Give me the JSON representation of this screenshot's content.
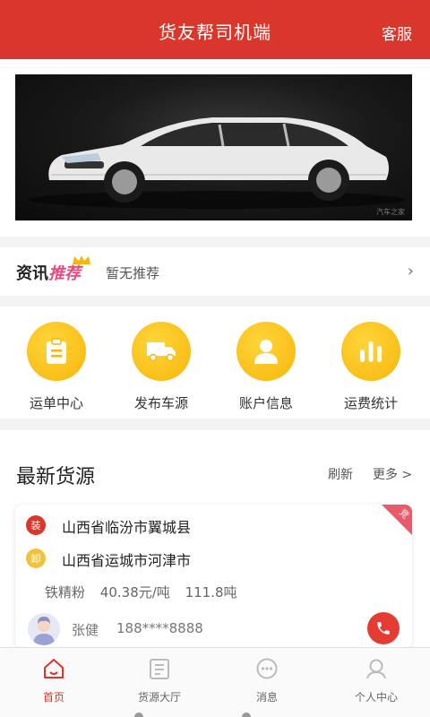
{
  "header": {
    "title": "货友帮司机端",
    "service": "客服"
  },
  "banner": {
    "watermark": "汽车之家"
  },
  "news": {
    "label_main": "资讯",
    "label_highlight": "推荐",
    "empty_text": "暂无推荐"
  },
  "menu": [
    {
      "label": "运单中心",
      "icon": "clipboard-icon"
    },
    {
      "label": "发布车源",
      "icon": "truck-icon"
    },
    {
      "label": "账户信息",
      "icon": "user-icon"
    },
    {
      "label": "运费统计",
      "icon": "bar-chart-icon"
    }
  ],
  "latest": {
    "heading": "最新货源",
    "refresh": "刷新",
    "more": "更多 >",
    "card": {
      "ribbon": "竞",
      "load_badge": "装",
      "load_address": "山西省临汾市翼城县",
      "unload_badge": "卸",
      "unload_address": "山西省运城市河津市",
      "goods_name": "铁精粉",
      "price": "40.38元/吨",
      "weight": "111.8吨",
      "contact_name": "张健",
      "contact_phone": "188****8888"
    }
  },
  "tabbar": [
    {
      "label": "首页",
      "active": true
    },
    {
      "label": "货源大厅",
      "active": false
    },
    {
      "label": "消息",
      "active": false
    },
    {
      "label": "个人中心",
      "active": false
    }
  ],
  "colors": {
    "brand_red": "#d9372b",
    "accent_yellow": "#f7b60b",
    "load_badge": "#d9372b",
    "unload_badge": "#f0c33c",
    "call": "#e53b33"
  }
}
